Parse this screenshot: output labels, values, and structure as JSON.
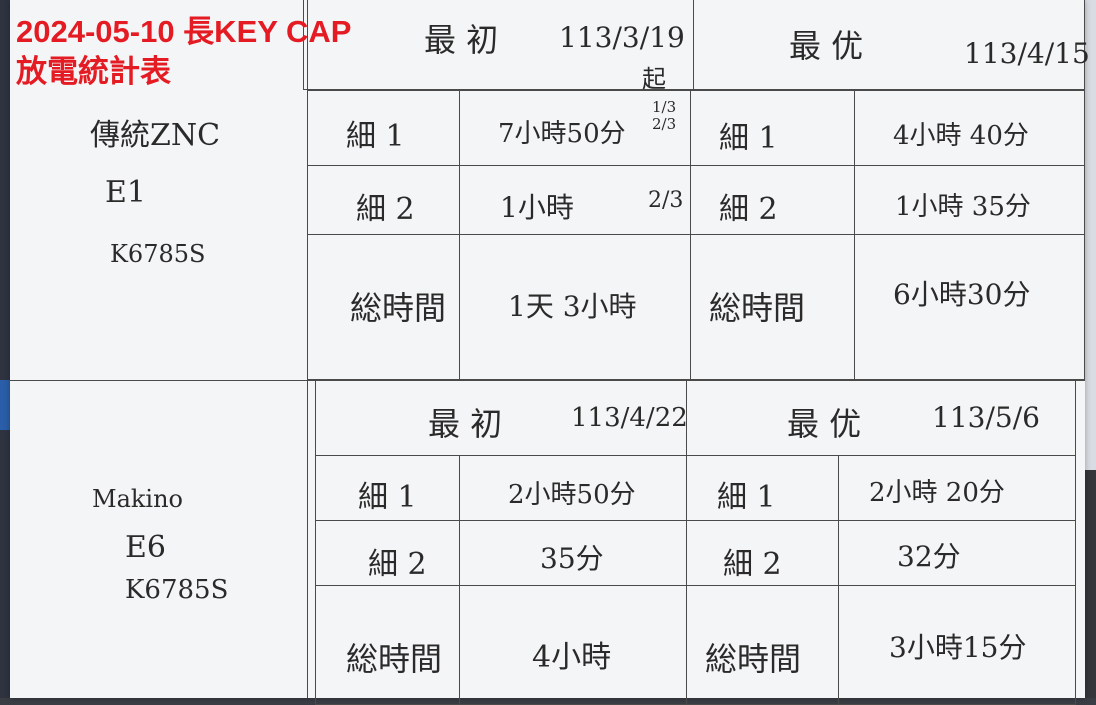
{
  "title": {
    "line1": "2024-05-10 長KEY CAP",
    "line2": "放電統計表"
  },
  "machine1": {
    "name": "傳統ZNC",
    "electrode": "E1",
    "part": "K6785S"
  },
  "machine2": {
    "name": "Makino",
    "electrode": "E6",
    "part": "K6785S"
  },
  "sections": [
    {
      "initial": {
        "label": "最 初",
        "date": "113/3/19",
        "note": "起"
      },
      "optimized": {
        "label": "最 优",
        "date": "113/4/15"
      },
      "rows": [
        {
          "label": "細 1",
          "initial": "7小時50分",
          "note": "1/3 2/3",
          "optimized": "4小時 40分"
        },
        {
          "label": "細 2",
          "initial": "1小時",
          "note": "2/3",
          "optimized": "1小時 35分"
        },
        {
          "label": "総時間",
          "initial": "1天 3小時",
          "note": "",
          "optimized": "6小時30分"
        }
      ]
    },
    {
      "initial": {
        "label": "最 初",
        "date": "113/4/22",
        "note": ""
      },
      "optimized": {
        "label": "最 优",
        "date": "113/5/6"
      },
      "rows": [
        {
          "label": "細 1",
          "initial": "2小時50分",
          "note": "",
          "optimized": "2小時 20分"
        },
        {
          "label": "細 2",
          "initial": "35分",
          "note": "",
          "optimized": "32分"
        },
        {
          "label": "総時間",
          "initial": "4小時",
          "note": "",
          "optimized": "3小時15分"
        }
      ]
    }
  ]
}
